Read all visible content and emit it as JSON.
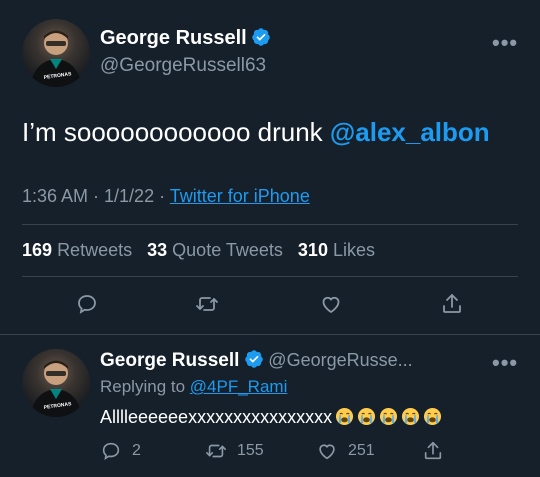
{
  "main_tweet": {
    "author_name": "George Russell",
    "author_handle": "@GeorgeRussell63",
    "text": "I’m soooooooooooo drunk",
    "mention": "@alex_albon",
    "time": "1:36 AM · 1/1/22 · ",
    "source": "Twitter for iPhone",
    "stats": {
      "retweets_count": "169",
      "retweets_label": "Retweets",
      "quotes_count": "33",
      "quotes_label": "Quote Tweets",
      "likes_count": "310",
      "likes_label": "Likes"
    },
    "avatar_text": "PETRONAS"
  },
  "reply_tweet": {
    "author_name": "George Russell",
    "author_handle": "@GeorgeRusse...",
    "replying_prefix": "Replying to ",
    "replying_to": "@4PF_Rami",
    "text": "Alllleeeeeexxxxxxxxxxxxxxxx",
    "emoji_count": 5,
    "reply_count": "2",
    "retweet_count": "155",
    "like_count": "251",
    "avatar_text": "PETRONAS"
  },
  "more_label": "•••",
  "colors": {
    "background": "#15202b",
    "accent": "#1d9bf0",
    "muted": "#8b98a5",
    "divider": "#38444d"
  },
  "icons": [
    "verified-badge-icon",
    "more-icon",
    "reply-icon",
    "retweet-icon",
    "like-icon",
    "share-icon",
    "crying-emoji-icon"
  ]
}
